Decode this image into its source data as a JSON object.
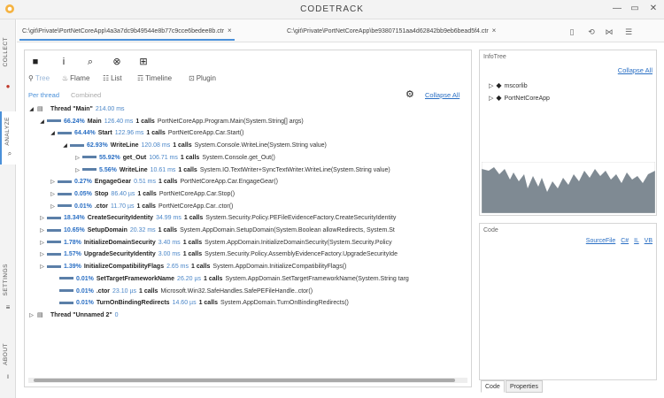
{
  "app": {
    "title": "CODETRACK"
  },
  "sidebar": {
    "items": [
      {
        "label": "COLLECT"
      },
      {
        "label": "ANALYZE"
      },
      {
        "label": "SETTINGS"
      },
      {
        "label": "ABOUT"
      }
    ]
  },
  "tabs": [
    {
      "label": "C:\\git\\Private\\PortNetCoreApp\\4a3a7dc9b49544e8b77c9cce6bedee8b.ctr",
      "close": "×"
    },
    {
      "label": "C:\\git\\Private\\PortNetCoreApp\\be93807151aa4d62842bb9eb6bead5f4.ctr",
      "close": "×"
    }
  ],
  "toolbar": {
    "modes": [
      {
        "label": "Tree",
        "icon": "tree-icon"
      },
      {
        "label": "Flame",
        "icon": "flame-icon"
      },
      {
        "label": "List",
        "icon": "list-icon"
      },
      {
        "label": "Timeline",
        "icon": "timeline-icon"
      },
      {
        "label": "Plugin",
        "icon": "plugin-icon"
      }
    ],
    "subtabs": [
      "Per thread",
      "Combined"
    ],
    "collapse_all": "Collapse All"
  },
  "tree": {
    "rows": [
      {
        "exp": "◢",
        "kind": "thread",
        "name": "Thread \"Main\"",
        "time": "214.00 ms"
      },
      {
        "exp": "◢",
        "pct": "66.24%",
        "name": "Main",
        "time": "126.40 ms",
        "calls": "1 calls",
        "full": "PortNetCoreApp.Program.Main(System.String[] args)"
      },
      {
        "exp": "◢",
        "pct": "64.44%",
        "name": "Start",
        "time": "122.96 ms",
        "calls": "1 calls",
        "full": "PortNetCoreApp.Car.Start()"
      },
      {
        "exp": "◢",
        "pct": "62.93%",
        "name": "WriteLine",
        "time": "120.08 ms",
        "calls": "1 calls",
        "full": "System.Console.WriteLine(System.String value)"
      },
      {
        "exp": "▷",
        "pct": "55.92%",
        "name": "get_Out",
        "time": "106.71 ms",
        "calls": "1 calls",
        "full": "System.Console.get_Out()"
      },
      {
        "exp": "▷",
        "pct": "5.56%",
        "name": "WriteLine",
        "time": "10.61 ms",
        "calls": "1 calls",
        "full": "System.IO.TextWriter+SyncTextWriter.WriteLine(System.String value)"
      },
      {
        "exp": "▷",
        "pct": "0.27%",
        "name": "EngageGear",
        "time": "0.51 ms",
        "calls": "1 calls",
        "full": "PortNetCoreApp.Car.EngageGear()"
      },
      {
        "exp": "▷",
        "pct": "0.05%",
        "name": "Stop",
        "time": "86.40 µs",
        "calls": "1 calls",
        "full": "PortNetCoreApp.Car.Stop()"
      },
      {
        "exp": "▷",
        "pct": "0.01%",
        "name": ".ctor",
        "time": "11.70 µs",
        "calls": "1 calls",
        "full": "PortNetCoreApp.Car..ctor()"
      },
      {
        "exp": "▷",
        "pct": "18.34%",
        "name": "CreateSecurityIdentity",
        "time": "34.99 ms",
        "calls": "1 calls",
        "full": "System.Security.Policy.PEFileEvidenceFactory.CreateSecurityIdentity"
      },
      {
        "exp": "▷",
        "pct": "10.65%",
        "name": "SetupDomain",
        "time": "20.32 ms",
        "calls": "1 calls",
        "full": "System.AppDomain.SetupDomain(System.Boolean allowRedirects, System.St"
      },
      {
        "exp": "▷",
        "pct": "1.78%",
        "name": "InitializeDomainSecurity",
        "time": "3.40 ms",
        "calls": "1 calls",
        "full": "System.AppDomain.InitializeDomainSecurity(System.Security.Policy"
      },
      {
        "exp": "▷",
        "pct": "1.57%",
        "name": "UpgradeSecurityIdentity",
        "time": "3.00 ms",
        "calls": "1 calls",
        "full": "System.Security.Policy.AssemblyEvidenceFactory.UpgradeSecurityIde"
      },
      {
        "exp": "▷",
        "pct": "1.39%",
        "name": "InitializeCompatibilityFlags",
        "time": "2.65 ms",
        "calls": "1 calls",
        "full": "System.AppDomain.InitializeCompatibilityFlags()"
      },
      {
        "exp": "",
        "pct": "0.01%",
        "name": "SetTargetFrameworkName",
        "time": "26.20 µs",
        "calls": "1 calls",
        "full": "System.AppDomain.SetTargetFrameworkName(System.String targ"
      },
      {
        "exp": "",
        "pct": "0.01%",
        "name": ".ctor",
        "time": "23.10 µs",
        "calls": "1 calls",
        "full": "Microsoft.Win32.SafeHandles.SafePEFileHandle..ctor()"
      },
      {
        "exp": "",
        "pct": "0.01%",
        "name": "TurnOnBindingRedirects",
        "time": "14.60 µs",
        "calls": "1 calls",
        "full": "System.AppDomain.TurnOnBindingRedirects()"
      },
      {
        "exp": "▷",
        "kind": "thread",
        "name": "Thread \"Unnamed 2\"",
        "time": "0"
      }
    ]
  },
  "infotree": {
    "title": "InfoTree",
    "collapse_all": "Collapse All",
    "items": [
      "mscorlib",
      "PortNetCoreApp"
    ]
  },
  "code": {
    "title": "Code",
    "links": [
      "SourceFile",
      "C#",
      "IL",
      "VB"
    ],
    "tabs": [
      "Code",
      "Properties"
    ]
  }
}
